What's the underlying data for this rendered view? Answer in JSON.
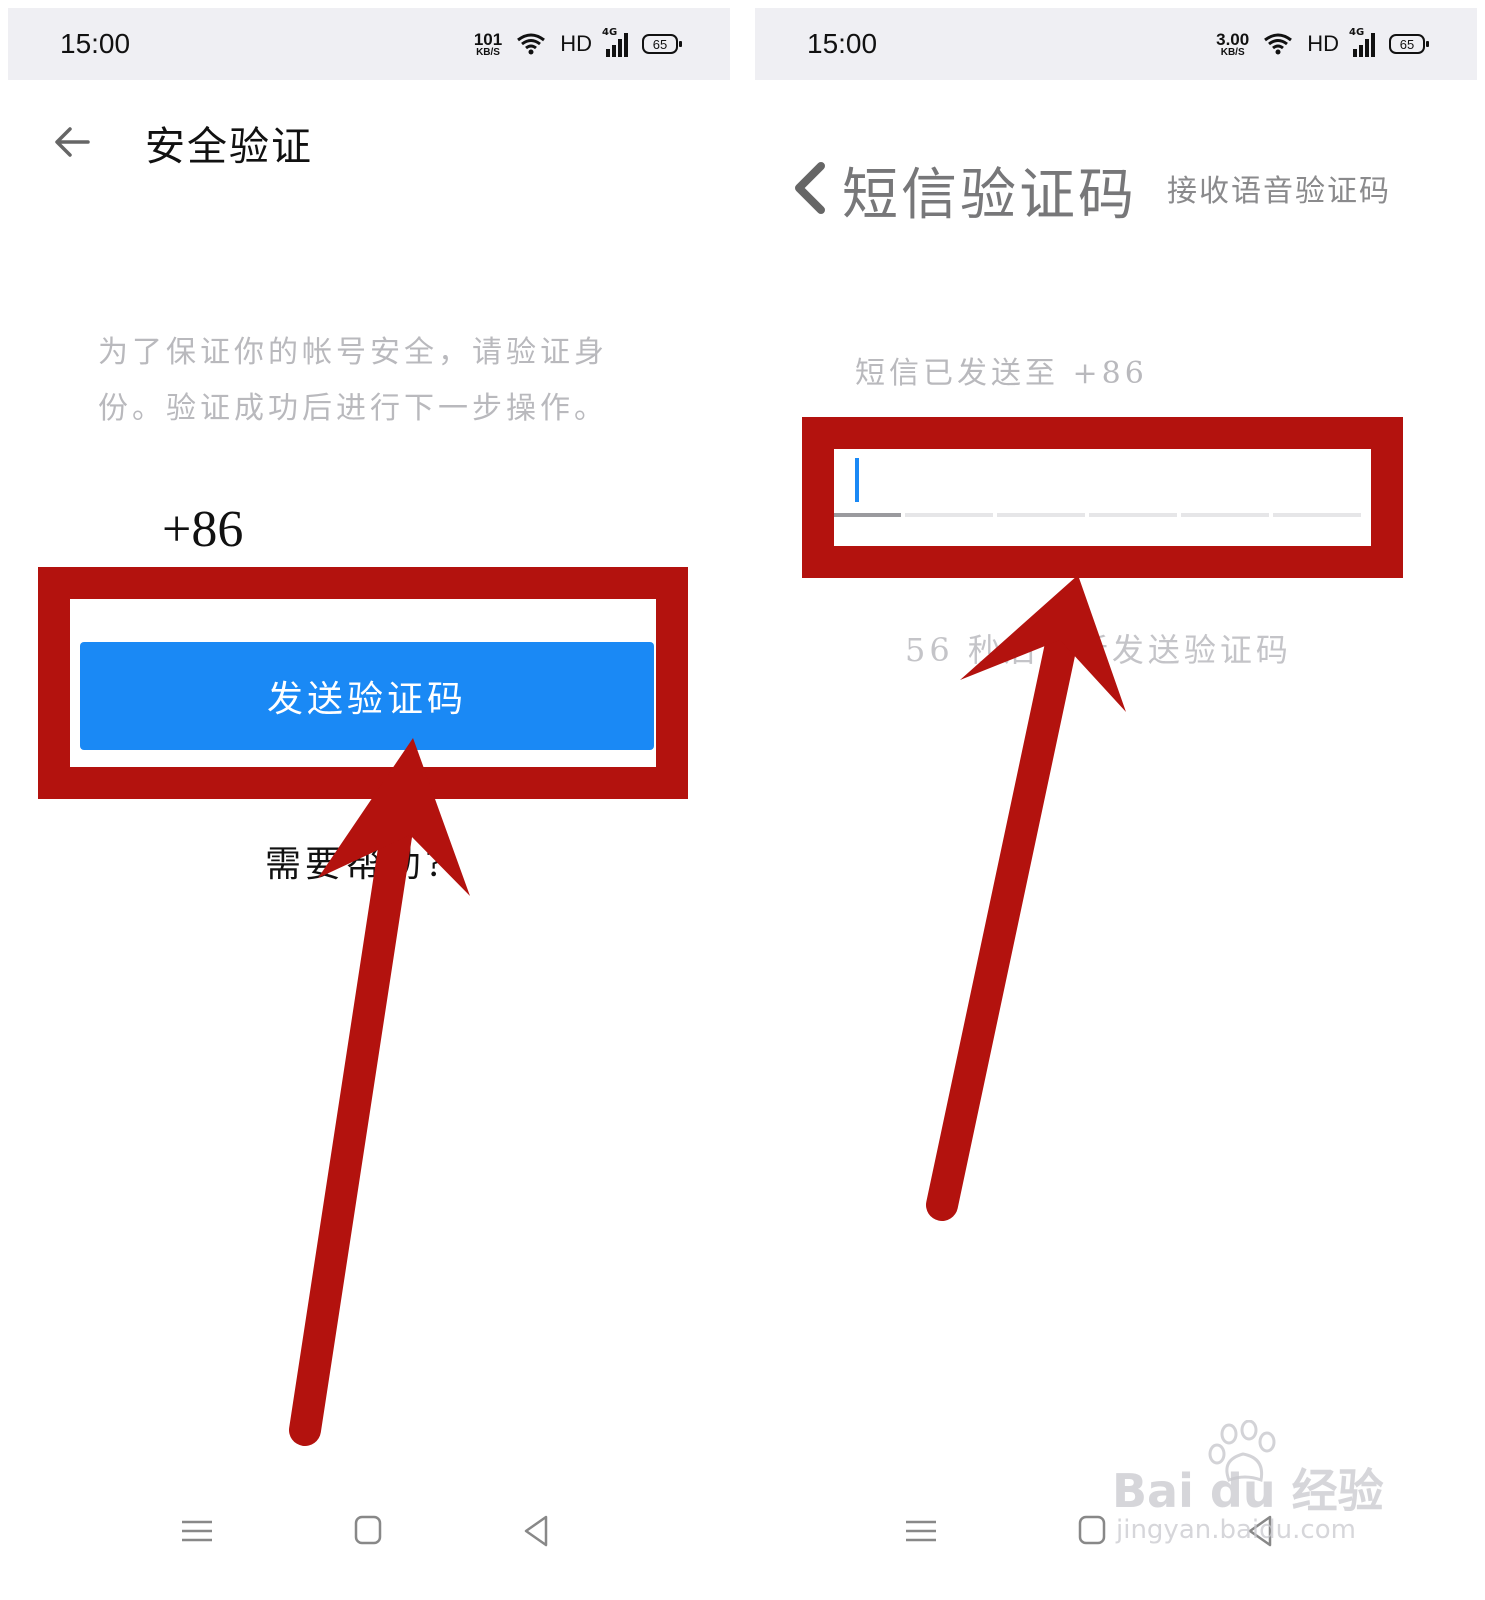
{
  "left": {
    "status_bar": {
      "time": "15:00",
      "speed_value": "101",
      "speed_unit": "KB/S",
      "hd": "HD",
      "network": "4G",
      "battery": "65"
    },
    "title": "安全验证",
    "description": "为了保证你的帐号安全，请验证身份。验证成功后进行下一步操作。",
    "phone_prefix": "+86",
    "send_button_label": "发送验证码",
    "help_link": "需要帮助?"
  },
  "right": {
    "status_bar": {
      "time": "15:00",
      "speed_value": "3.00",
      "speed_unit": "KB/S",
      "hd": "HD",
      "network": "4G",
      "battery": "65"
    },
    "title": "短信验证码",
    "voice_code_link": "接收语音验证码",
    "sent_to": "短信已发送至 +86",
    "resend_text": "56 秒后重新发送验证码",
    "code_length": 6
  },
  "watermark": {
    "brand": "Bai du 经验",
    "url": "jingyan.baidu.com"
  },
  "colors": {
    "accent_blue": "#1a89f5",
    "annotation_red": "#b3120e"
  },
  "icons": [
    "back-arrow-icon",
    "chevron-left-icon",
    "wifi-icon",
    "signal-icon",
    "battery-icon",
    "menu-icon",
    "home-icon",
    "back-triangle-icon",
    "paw-icon"
  ]
}
